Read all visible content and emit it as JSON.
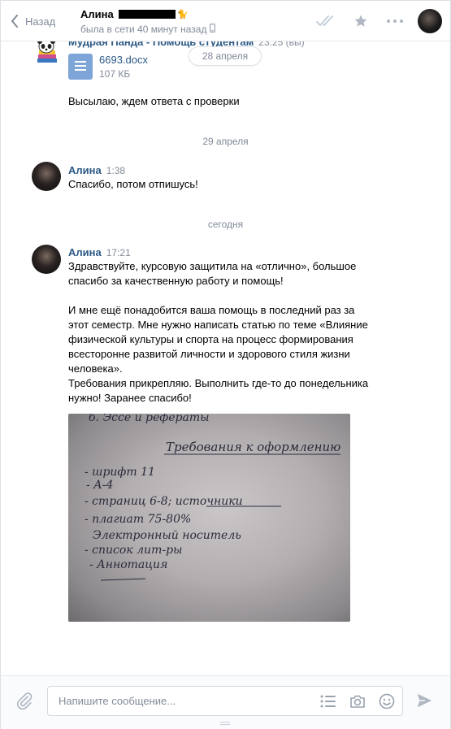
{
  "header": {
    "back_label": "Назад",
    "peer_name": "Алина",
    "peer_status": "была в сети 40 минут назад"
  },
  "messages": {
    "m1": {
      "author": "Мудрая Панда - Помощь студентам",
      "time": "23:25 (вы)",
      "doc_name": "6693.docx",
      "doc_size": "107 КБ",
      "text": "Высылаю, ждем ответа с проверки"
    },
    "floating_date": "28 апреля",
    "sep1": "29 апреля",
    "m2": {
      "author": "Алина",
      "time": "1:38",
      "text": "Спасибо, потом отпишусь!"
    },
    "sep2": "сегодня",
    "m3": {
      "author": "Алина",
      "time": "17:21",
      "text": "Здравствуйте, курсовую защитила на «отлично», большое спасибо за качественную работу и помощь!\n\nИ мне ещё понадобится ваша помощь в последний раз за этот семестр. Мне нужно написать статью по теме «Влияние физической культуры и спорта на процесс формирования всесторонне развитой личности и здорового стиля жизни человека».\nТребования прикрепляю. Выполнить где-то до понедельника нужно! Заранее спасибо!"
    }
  },
  "photo_text": {
    "line0": "б. Эссе и рефераты",
    "title": "Требования к оформлению",
    "l1": "- шрифт 11",
    "l2": "- А-4",
    "l3": "- страниц 6-8; источники",
    "l4": "- плагиат 75-80%",
    "l5": "Электронный носитель",
    "l6": "- список лит-ры",
    "l7": "- Аннотация"
  },
  "composer": {
    "placeholder": "Напишите сообщение..."
  },
  "colors": {
    "accent": "#2a5885",
    "muted": "#828a99",
    "doc_icon": "#7ea5d7"
  }
}
